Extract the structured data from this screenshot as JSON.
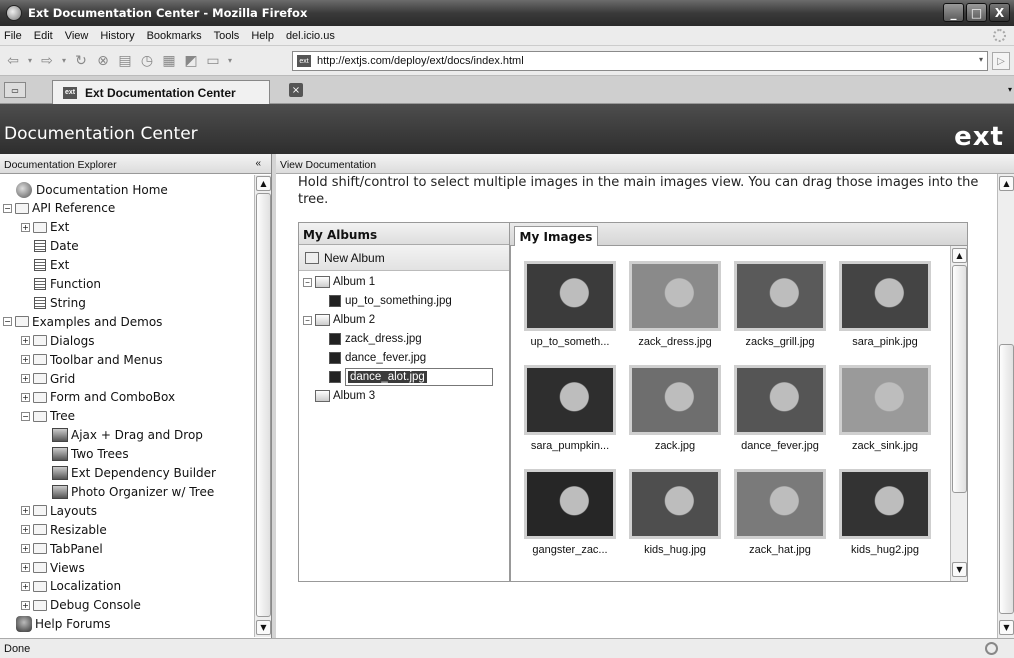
{
  "window": {
    "title": "Ext Documentation Center - Mozilla Firefox",
    "buttons": [
      "_",
      "□",
      "X"
    ]
  },
  "menu": [
    "File",
    "Edit",
    "View",
    "History",
    "Bookmarks",
    "Tools",
    "Help",
    "del.icio.us"
  ],
  "address": {
    "url": "http://extjs.com/deploy/ext/docs/index.html"
  },
  "tabs": [
    {
      "label": "Ext Documentation Center"
    }
  ],
  "app": {
    "title": "Documentation Center",
    "logo": "ext"
  },
  "west": {
    "header": "Documentation Explorer",
    "collapse": "«",
    "tree": [
      {
        "label": "Documentation Home",
        "level": 0,
        "icon": "home-icon"
      },
      {
        "label": "API Reference",
        "level": 0,
        "icon": "folder-open-icon",
        "exp": "−"
      },
      {
        "label": "Ext",
        "level": 1,
        "icon": "folder-icon",
        "exp": "+"
      },
      {
        "label": "Date",
        "level": 1,
        "icon": "page-icon"
      },
      {
        "label": "Ext",
        "level": 1,
        "icon": "page-icon"
      },
      {
        "label": "Function",
        "level": 1,
        "icon": "page-icon"
      },
      {
        "label": "String",
        "level": 1,
        "icon": "page-icon"
      },
      {
        "label": "Examples and Demos",
        "level": 0,
        "icon": "folder-open-icon",
        "exp": "−"
      },
      {
        "label": "Dialogs",
        "level": 1,
        "icon": "folder-icon",
        "exp": "+"
      },
      {
        "label": "Toolbar and Menus",
        "level": 1,
        "icon": "folder-icon",
        "exp": "+"
      },
      {
        "label": "Grid",
        "level": 1,
        "icon": "folder-icon",
        "exp": "+"
      },
      {
        "label": "Form and ComboBox",
        "level": 1,
        "icon": "folder-icon",
        "exp": "+"
      },
      {
        "label": "Tree",
        "level": 1,
        "icon": "folder-open-icon",
        "exp": "−"
      },
      {
        "label": "Ajax + Drag and Drop",
        "level": 2,
        "icon": "demo-icon"
      },
      {
        "label": "Two Trees",
        "level": 2,
        "icon": "demo-icon"
      },
      {
        "label": "Ext Dependency Builder",
        "level": 2,
        "icon": "demo-icon"
      },
      {
        "label": "Photo Organizer w/ Tree",
        "level": 2,
        "icon": "demo-icon"
      },
      {
        "label": "Layouts",
        "level": 1,
        "icon": "folder-icon",
        "exp": "+"
      },
      {
        "label": "Resizable",
        "level": 1,
        "icon": "folder-icon",
        "exp": "+"
      },
      {
        "label": "TabPanel",
        "level": 1,
        "icon": "folder-icon",
        "exp": "+"
      },
      {
        "label": "Views",
        "level": 1,
        "icon": "folder-icon",
        "exp": "+"
      },
      {
        "label": "Localization",
        "level": 1,
        "icon": "folder-icon",
        "exp": "+"
      },
      {
        "label": "Debug Console",
        "level": 1,
        "icon": "folder-icon",
        "exp": "+"
      },
      {
        "label": "Help Forums",
        "level": 0,
        "icon": "help-icon"
      }
    ]
  },
  "center": {
    "header": "View Documentation",
    "instructions": "Hold shift/control to select multiple images in the main images view. You can drag those images into the tree."
  },
  "albums": {
    "title": "My Albums",
    "new_album": "New Album",
    "tree": [
      {
        "label": "Album 1",
        "type": "album",
        "exp": "−"
      },
      {
        "label": "up_to_something.jpg",
        "type": "image"
      },
      {
        "label": "Album 2",
        "type": "album",
        "exp": "−"
      },
      {
        "label": "zack_dress.jpg",
        "type": "image"
      },
      {
        "label": "dance_fever.jpg",
        "type": "image"
      },
      {
        "label": "dance_alot.jpg",
        "type": "image",
        "editing": true
      },
      {
        "label": "Album 3",
        "type": "album"
      }
    ]
  },
  "images": {
    "tab": "My Images",
    "items": [
      {
        "caption": "up_to_someth...",
        "shade": "#3b3b3b"
      },
      {
        "caption": "zack_dress.jpg",
        "shade": "#8a8a8a"
      },
      {
        "caption": "zacks_grill.jpg",
        "shade": "#5a5a5a"
      },
      {
        "caption": "sara_pink.jpg",
        "shade": "#444444"
      },
      {
        "caption": "sara_pumpkin...",
        "shade": "#2e2e2e"
      },
      {
        "caption": "zack.jpg",
        "shade": "#6e6e6e"
      },
      {
        "caption": "dance_fever.jpg",
        "shade": "#555555"
      },
      {
        "caption": "zack_sink.jpg",
        "shade": "#9a9a9a"
      },
      {
        "caption": "gangster_zac...",
        "shade": "#262626"
      },
      {
        "caption": "kids_hug.jpg",
        "shade": "#4e4e4e"
      },
      {
        "caption": "zack_hat.jpg",
        "shade": "#7a7a7a"
      },
      {
        "caption": "kids_hug2.jpg",
        "shade": "#333333"
      }
    ]
  },
  "status": {
    "text": "Done"
  }
}
